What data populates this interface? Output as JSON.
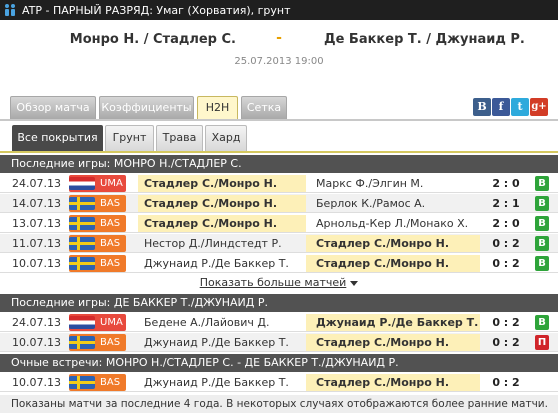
{
  "title": "ATP - ПАРНЫЙ РАЗРЯД: Умаг (Хорватия), грунт",
  "match": {
    "home": "Монро Н. / Стадлер С.",
    "separator": "-",
    "away": "Де Баккер Т. / Джунаид Р.",
    "datetime": "25.07.2013 19:00"
  },
  "tabs": [
    "Обзор матча",
    "Коэффициенты",
    "H2H",
    "Сетка"
  ],
  "active_tab": "H2H",
  "share_buttons": [
    {
      "icon": "vk-icon",
      "glyph": "B",
      "color": "#3d5f8c"
    },
    {
      "icon": "facebook-icon",
      "glyph": "f",
      "color": "#3b5998"
    },
    {
      "icon": "twitter-icon",
      "glyph": "t",
      "color": "#2eaadc"
    },
    {
      "icon": "google-plus-icon",
      "glyph": "g+",
      "color": "#d23c26"
    }
  ],
  "subtabs": [
    "Все покрытия",
    "Грунт",
    "Трава",
    "Хард"
  ],
  "active_subtab": "Все покрытия",
  "colors": {
    "accent": "#fdf0b8",
    "win": "#2ea43a",
    "loss": "#d0252a",
    "header": "#525252"
  },
  "sections": {
    "home": {
      "title": "Последние игры: МОНРО Н./СТАДЛЕР С.",
      "rows": [
        {
          "date": "24.07.13",
          "flag": "croatia-flag",
          "tour": "UMA",
          "tour_color": "#e84a3d",
          "home": "Стадлер С./Монро Н.",
          "away": "Маркс Ф./Элгин М.",
          "winner": "home",
          "score": "2 : 0",
          "result": "В",
          "result_type": "w"
        },
        {
          "date": "14.07.13",
          "flag": "sweden-flag",
          "tour": "BAS",
          "tour_color": "#f07a2a",
          "home": "Стадлер С./Монро Н.",
          "away": "Берлок К./Рамос А.",
          "winner": "home",
          "score": "2 : 1",
          "result": "В",
          "result_type": "w"
        },
        {
          "date": "13.07.13",
          "flag": "sweden-flag",
          "tour": "BAS",
          "tour_color": "#f07a2a",
          "home": "Стадлер С./Монро Н.",
          "away": "Арнольд-Кер Л./Монако Х.",
          "winner": "home",
          "score": "2 : 0",
          "result": "В",
          "result_type": "w"
        },
        {
          "date": "11.07.13",
          "flag": "sweden-flag",
          "tour": "BAS",
          "tour_color": "#f07a2a",
          "home": "Нестор Д./Линдстедт Р.",
          "away": "Стадлер С./Монро Н.",
          "winner": "away",
          "score": "0 : 2",
          "result": "В",
          "result_type": "w"
        },
        {
          "date": "10.07.13",
          "flag": "sweden-flag",
          "tour": "BAS",
          "tour_color": "#f07a2a",
          "home": "Джунаид Р./Де Баккер Т.",
          "away": "Стадлер С./Монро Н.",
          "winner": "away",
          "score": "0 : 2",
          "result": "В",
          "result_type": "w"
        }
      ]
    },
    "more_label": "Показать больше матчей",
    "away": {
      "title": "Последние игры: ДЕ БАККЕР Т./ДЖУНАИД Р.",
      "rows": [
        {
          "date": "24.07.13",
          "flag": "croatia-flag",
          "tour": "UMA",
          "tour_color": "#e84a3d",
          "home": "Бедене А./Лайович Д.",
          "away": "Джунаид Р./Де Баккер Т.",
          "winner": "away",
          "score": "0 : 2",
          "result": "В",
          "result_type": "w"
        },
        {
          "date": "10.07.13",
          "flag": "sweden-flag",
          "tour": "BAS",
          "tour_color": "#f07a2a",
          "home": "Джунаид Р./Де Баккер Т.",
          "away": "Стадлер С./Монро Н.",
          "winner": "away",
          "score": "0 : 2",
          "result": "П",
          "result_type": "l"
        }
      ]
    },
    "h2h": {
      "title": "Очные встречи: МОНРО Н./СТАДЛЕР С. - ДЕ БАККЕР Т./ДЖУНАИД Р.",
      "rows": [
        {
          "date": "10.07.13",
          "flag": "sweden-flag",
          "tour": "BAS",
          "tour_color": "#f07a2a",
          "home": "Джунаид Р./Де Баккер Т.",
          "away": "Стадлер С./Монро Н.",
          "winner": "away",
          "score": "0 : 2",
          "result": "",
          "result_type": ""
        }
      ]
    }
  },
  "footnote": "Показаны матчи за последние 4 года. В некоторых случаях отображаются более ранние матчи."
}
